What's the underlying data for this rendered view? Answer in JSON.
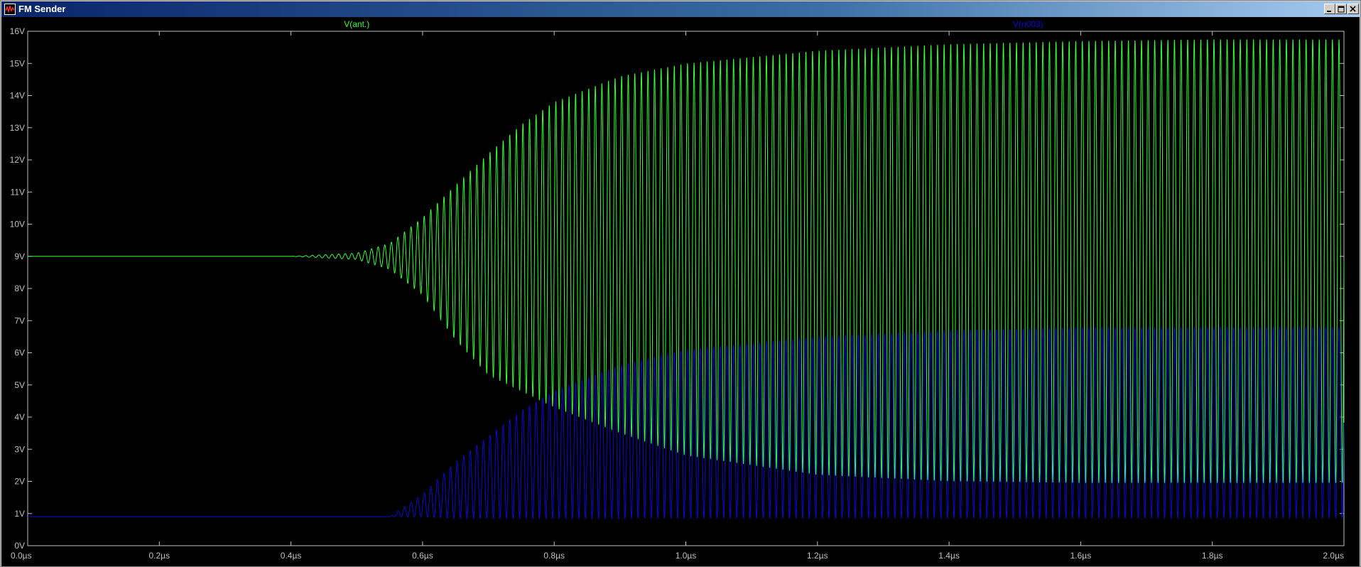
{
  "window": {
    "title": "FM Sender",
    "buttons": {
      "minimize": "_",
      "maximize": "□",
      "close": "×"
    }
  },
  "colors": {
    "background": "#000000",
    "axis": "#c0c0c0",
    "trace_ant": "#33ff33",
    "trace_n003": "#0a0ad8"
  },
  "chart_data": {
    "type": "line",
    "title": "",
    "xlabel": "",
    "ylabel": "",
    "xlim": [
      0.0,
      2.0
    ],
    "ylim": [
      0,
      16
    ],
    "x_unit": "µs",
    "y_unit": "V",
    "x_ticks": [
      "0.0µs",
      "0.2µs",
      "0.4µs",
      "0.6µs",
      "0.8µs",
      "1.0µs",
      "1.2µs",
      "1.4µs",
      "1.6µs",
      "1.8µs",
      "2.0µs"
    ],
    "y_ticks": [
      "0V",
      "1V",
      "2V",
      "3V",
      "4V",
      "5V",
      "6V",
      "7V",
      "8V",
      "9V",
      "10V",
      "11V",
      "12V",
      "13V",
      "14V",
      "15V",
      "16V"
    ],
    "grid": false,
    "series": [
      {
        "name": "V(ant.)",
        "color": "#33ff33",
        "baseline_V": 9.0,
        "oscillation_start_us": 0.4,
        "oscillation_frequency_MHz": 100,
        "envelope_x_us": [
          0.0,
          0.4,
          0.5,
          0.55,
          0.6,
          0.65,
          0.7,
          0.75,
          0.8,
          0.9,
          1.0,
          1.1,
          1.2,
          1.4,
          1.6,
          1.8,
          2.0
        ],
        "envelope_max_V": [
          9.0,
          9.0,
          9.1,
          9.4,
          10.2,
          11.2,
          12.2,
          13.1,
          13.8,
          14.6,
          15.0,
          15.2,
          15.4,
          15.6,
          15.7,
          15.75,
          15.75
        ],
        "envelope_min_V": [
          9.0,
          9.0,
          8.9,
          8.6,
          7.8,
          6.4,
          5.3,
          4.8,
          4.3,
          3.5,
          2.8,
          2.5,
          2.2,
          2.0,
          1.95,
          1.95,
          1.95
        ]
      },
      {
        "name": "V(n003)",
        "color": "#0a0ad8",
        "baseline_V": 0.9,
        "oscillation_start_us": 0.55,
        "oscillation_frequency_MHz": 100,
        "envelope_x_us": [
          0.0,
          0.55,
          0.6,
          0.65,
          0.7,
          0.75,
          0.8,
          0.9,
          1.0,
          1.1,
          1.2,
          1.4,
          1.6,
          1.8,
          2.0
        ],
        "envelope_max_V": [
          0.9,
          0.9,
          1.6,
          2.6,
          3.4,
          4.2,
          4.8,
          5.6,
          6.1,
          6.3,
          6.5,
          6.7,
          6.8,
          6.8,
          6.8
        ],
        "envelope_min_V": [
          0.9,
          0.9,
          0.9,
          0.85,
          0.85,
          0.85,
          0.85,
          0.85,
          0.85,
          0.85,
          0.85,
          0.85,
          0.85,
          0.85,
          0.85
        ]
      }
    ]
  }
}
